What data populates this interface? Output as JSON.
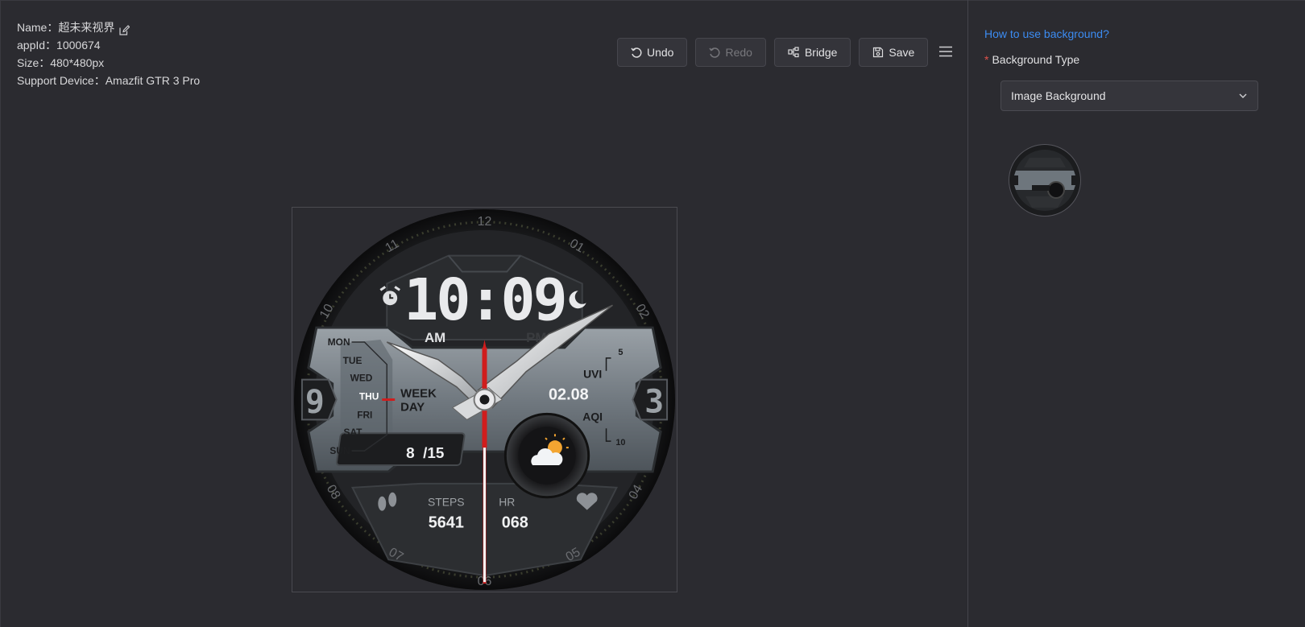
{
  "info": {
    "name_label": "Name：",
    "name_value": "超未来视界",
    "appid_label": "appId：",
    "appid_value": "1000674",
    "size_label": "Size：",
    "size_value": "480*480px",
    "device_label": "Support Device：",
    "device_value": "Amazfit GTR 3 Pro"
  },
  "toolbar": {
    "undo": "Undo",
    "redo": "Redo",
    "bridge": "Bridge",
    "save": "Save"
  },
  "watch": {
    "time": "10:09",
    "am": "AM",
    "pm": "PM",
    "days": [
      "MON",
      "TUE",
      "WED",
      "THU",
      "FRI",
      "SAT",
      "SUN"
    ],
    "week_line1": "WEEK",
    "week_line2": "DAY",
    "date": "02.08",
    "uvi": "UVI",
    "aqi": "AQI",
    "uvi_top": "5",
    "aqi_bottom": "10",
    "month_day": "8  /15",
    "steps_label": "STEPS",
    "steps_value": "5641",
    "hr_label": "HR",
    "hr_value": "068",
    "num_9": "9",
    "num_3": "3",
    "bezel": [
      "12",
      "01",
      "02",
      "04",
      "05",
      "06",
      "07",
      "08",
      "10",
      "11"
    ]
  },
  "panel": {
    "help_link": "How to use background?",
    "bg_type_label": "Background Type",
    "bg_type_value": "Image Background"
  },
  "colors": {
    "accent_link": "#3c8cf2",
    "required": "#e0524b",
    "second_hand": "#d01d1d"
  }
}
